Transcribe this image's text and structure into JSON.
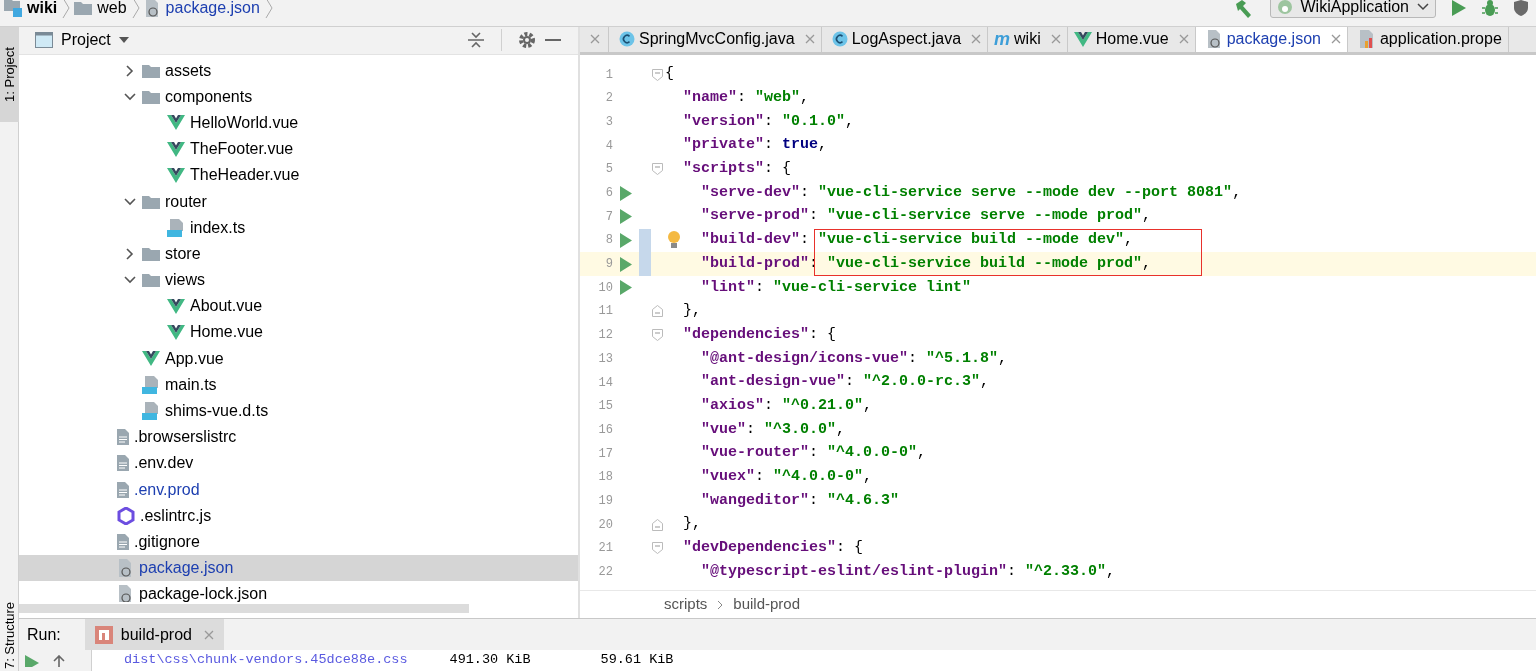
{
  "breadcrumb": [
    {
      "label": "wiki",
      "kind": "module"
    },
    {
      "label": "web",
      "kind": "folder"
    },
    {
      "label": "package.json",
      "kind": "json"
    }
  ],
  "toolbar": {
    "run_config": "WikiApplication"
  },
  "side_tabs": [
    {
      "label": "1: Project",
      "selected": true
    },
    {
      "label": "7: Structure",
      "selected": false
    }
  ],
  "project_panel": {
    "title": "Project",
    "tree": [
      {
        "children": [
          {
            "label": "assets",
            "kind": "folder",
            "expanded": false,
            "selected": false,
            "modified": false
          },
          {
            "label": "components",
            "kind": "folder",
            "expanded": true,
            "selected": false,
            "modified": false,
            "children": [
              {
                "label": "HelloWorld.vue",
                "kind": "vue",
                "selected": false,
                "modified": false
              },
              {
                "label": "TheFooter.vue",
                "kind": "vue",
                "selected": false,
                "modified": false
              },
              {
                "label": "TheHeader.vue",
                "kind": "vue",
                "selected": false,
                "modified": false
              }
            ]
          },
          {
            "label": "router",
            "kind": "folder",
            "expanded": true,
            "selected": false,
            "modified": false,
            "children": [
              {
                "label": "index.ts",
                "kind": "ts",
                "selected": false,
                "modified": false
              }
            ]
          },
          {
            "label": "store",
            "kind": "folder",
            "expanded": false,
            "selected": false,
            "modified": false
          },
          {
            "label": "views",
            "kind": "folder",
            "expanded": true,
            "selected": false,
            "modified": false,
            "children": [
              {
                "label": "About.vue",
                "kind": "vue",
                "selected": false,
                "modified": false
              },
              {
                "label": "Home.vue",
                "kind": "vue",
                "selected": false,
                "modified": false
              }
            ]
          },
          {
            "label": "App.vue",
            "kind": "vue",
            "selected": false,
            "modified": false
          },
          {
            "label": "main.ts",
            "kind": "ts",
            "selected": false,
            "modified": false
          },
          {
            "label": "shims-vue.d.ts",
            "kind": "ts",
            "selected": false,
            "modified": false
          }
        ]
      },
      {
        "label": ".browserslistrc",
        "kind": "text",
        "selected": false,
        "modified": false
      },
      {
        "label": ".env.dev",
        "kind": "text",
        "selected": false,
        "modified": false
      },
      {
        "label": ".env.prod",
        "kind": "text",
        "selected": false,
        "modified": true
      },
      {
        "label": ".eslintrc.js",
        "kind": "eslint",
        "selected": false,
        "modified": false
      },
      {
        "label": ".gitignore",
        "kind": "text",
        "selected": false,
        "modified": false
      },
      {
        "label": "package.json",
        "kind": "json",
        "selected": true,
        "modified": true
      },
      {
        "label": "package-lock.json",
        "kind": "json",
        "selected": false,
        "modified": false
      }
    ]
  },
  "editor": {
    "tabs": [
      {
        "kind": "cut",
        "selected": false
      },
      {
        "label": "SpringMvcConfig.java",
        "kind": "java",
        "selected": false
      },
      {
        "label": "LogAspect.java",
        "kind": "java",
        "selected": false
      },
      {
        "label": "wiki",
        "kind": "maven",
        "glyph": "m",
        "selected": false
      },
      {
        "label": "Home.vue",
        "kind": "vue",
        "selected": false
      },
      {
        "label": "package.json",
        "kind": "json",
        "selected": true
      },
      {
        "label": "application.prope",
        "kind": "properties",
        "selected": false
      }
    ],
    "lines": [
      {
        "number": "1",
        "fold_start": true,
        "tokens": [
          {
            "kind": "punct",
            "text": "{"
          }
        ]
      },
      {
        "number": "2",
        "tokens": [
          {
            "kind": "key",
            "text": "  \"name\""
          },
          {
            "kind": "punct",
            "text": ": "
          },
          {
            "kind": "string",
            "text": "\"web\""
          },
          {
            "kind": "punct",
            "text": ","
          }
        ]
      },
      {
        "number": "3",
        "tokens": [
          {
            "kind": "key",
            "text": "  \"version\""
          },
          {
            "kind": "punct",
            "text": ": "
          },
          {
            "kind": "string",
            "text": "\"0.1.0\""
          },
          {
            "kind": "punct",
            "text": ","
          }
        ]
      },
      {
        "number": "4",
        "tokens": [
          {
            "kind": "key",
            "text": "  \"private\""
          },
          {
            "kind": "punct",
            "text": ": "
          },
          {
            "kind": "keyword",
            "text": "true"
          },
          {
            "kind": "punct",
            "text": ","
          }
        ]
      },
      {
        "number": "5",
        "fold_start": true,
        "tokens": [
          {
            "kind": "key",
            "text": "  \"scripts\""
          },
          {
            "kind": "punct",
            "text": ": {"
          }
        ]
      },
      {
        "number": "6",
        "runnable": true,
        "tokens": [
          {
            "kind": "key",
            "text": "    \"serve-dev\""
          },
          {
            "kind": "punct",
            "text": ": "
          },
          {
            "kind": "string",
            "text": "\"vue-cli-service serve --mode dev --port 8081\""
          },
          {
            "kind": "punct",
            "text": ","
          }
        ]
      },
      {
        "number": "7",
        "runnable": true,
        "tokens": [
          {
            "kind": "key",
            "text": "    \"serve-prod\""
          },
          {
            "kind": "punct",
            "text": ": "
          },
          {
            "kind": "string",
            "text": "\"vue-cli-service serve --mode prod\""
          },
          {
            "kind": "punct",
            "text": ","
          }
        ]
      },
      {
        "number": "8",
        "runnable": true,
        "changed": true,
        "hint": true,
        "boxed": true,
        "tokens": [
          {
            "kind": "key",
            "text": "    \"build-dev\""
          },
          {
            "kind": "punct",
            "text": ": "
          },
          {
            "kind": "string",
            "text": "\"vue-cli-service build --mode dev\""
          },
          {
            "kind": "punct",
            "text": ","
          }
        ]
      },
      {
        "number": "9",
        "runnable": true,
        "changed": true,
        "current": true,
        "boxed": true,
        "tokens": [
          {
            "kind": "key",
            "text": "    \"build-prod\""
          },
          {
            "kind": "punct",
            "text": ": "
          },
          {
            "kind": "string",
            "text": "\"vue-cli-service build --mode prod\""
          },
          {
            "kind": "punct",
            "text": ","
          }
        ]
      },
      {
        "number": "10",
        "runnable": true,
        "tokens": [
          {
            "kind": "key",
            "text": "    \"lint\""
          },
          {
            "kind": "punct",
            "text": ": "
          },
          {
            "kind": "string",
            "text": "\"vue-cli-service lint\""
          }
        ]
      },
      {
        "number": "11",
        "fold_end": true,
        "tokens": [
          {
            "kind": "punct",
            "text": "  },"
          }
        ]
      },
      {
        "number": "12",
        "fold_start": true,
        "tokens": [
          {
            "kind": "key",
            "text": "  \"dependencies\""
          },
          {
            "kind": "punct",
            "text": ": {"
          }
        ]
      },
      {
        "number": "13",
        "tokens": [
          {
            "kind": "key",
            "text": "    \"@ant-design/icons-vue\""
          },
          {
            "kind": "punct",
            "text": ": "
          },
          {
            "kind": "string",
            "text": "\"^5.1.8\""
          },
          {
            "kind": "punct",
            "text": ","
          }
        ]
      },
      {
        "number": "14",
        "tokens": [
          {
            "kind": "key",
            "text": "    \"ant-design-vue\""
          },
          {
            "kind": "punct",
            "text": ": "
          },
          {
            "kind": "string",
            "text": "\"^2.0.0-rc.3\""
          },
          {
            "kind": "punct",
            "text": ","
          }
        ]
      },
      {
        "number": "15",
        "tokens": [
          {
            "kind": "key",
            "text": "    \"axios\""
          },
          {
            "kind": "punct",
            "text": ": "
          },
          {
            "kind": "string",
            "text": "\"^0.21.0\""
          },
          {
            "kind": "punct",
            "text": ","
          }
        ]
      },
      {
        "number": "16",
        "tokens": [
          {
            "kind": "key",
            "text": "    \"vue\""
          },
          {
            "kind": "punct",
            "text": ": "
          },
          {
            "kind": "string",
            "text": "\"^3.0.0\""
          },
          {
            "kind": "punct",
            "text": ","
          }
        ]
      },
      {
        "number": "17",
        "tokens": [
          {
            "kind": "key",
            "text": "    \"vue-router\""
          },
          {
            "kind": "punct",
            "text": ": "
          },
          {
            "kind": "string",
            "text": "\"^4.0.0-0\""
          },
          {
            "kind": "punct",
            "text": ","
          }
        ]
      },
      {
        "number": "18",
        "tokens": [
          {
            "kind": "key",
            "text": "    \"vuex\""
          },
          {
            "kind": "punct",
            "text": ": "
          },
          {
            "kind": "string",
            "text": "\"^4.0.0-0\""
          },
          {
            "kind": "punct",
            "text": ","
          }
        ]
      },
      {
        "number": "19",
        "tokens": [
          {
            "kind": "key",
            "text": "    \"wangeditor\""
          },
          {
            "kind": "punct",
            "text": ": "
          },
          {
            "kind": "string",
            "text": "\"^4.6.3\""
          }
        ]
      },
      {
        "number": "20",
        "fold_end": true,
        "tokens": [
          {
            "kind": "punct",
            "text": "  },"
          }
        ]
      },
      {
        "number": "21",
        "fold_start": true,
        "tokens": [
          {
            "kind": "key",
            "text": "  \"devDependencies\""
          },
          {
            "kind": "punct",
            "text": ": {"
          }
        ]
      },
      {
        "number": "22",
        "tokens": [
          {
            "kind": "key",
            "text": "    \"@typescript-eslint/eslint-plugin\""
          },
          {
            "kind": "punct",
            "text": ": "
          },
          {
            "kind": "string",
            "text": "\"^2.33.0\""
          },
          {
            "kind": "punct",
            "text": ","
          }
        ]
      }
    ],
    "breadcrumb": [
      "scripts",
      "build-prod"
    ]
  },
  "run_panel": {
    "label": "Run:",
    "tabs": [
      {
        "label": "build-prod",
        "selected": true
      }
    ],
    "output": [
      {
        "columns": [
          {
            "kind": "path",
            "text": "dist\\css\\chunk-vendors.45dce88e.css"
          },
          {
            "kind": "size",
            "text": "491.30 KiB"
          },
          {
            "kind": "size",
            "text": "59.61 KiB"
          }
        ]
      }
    ]
  }
}
